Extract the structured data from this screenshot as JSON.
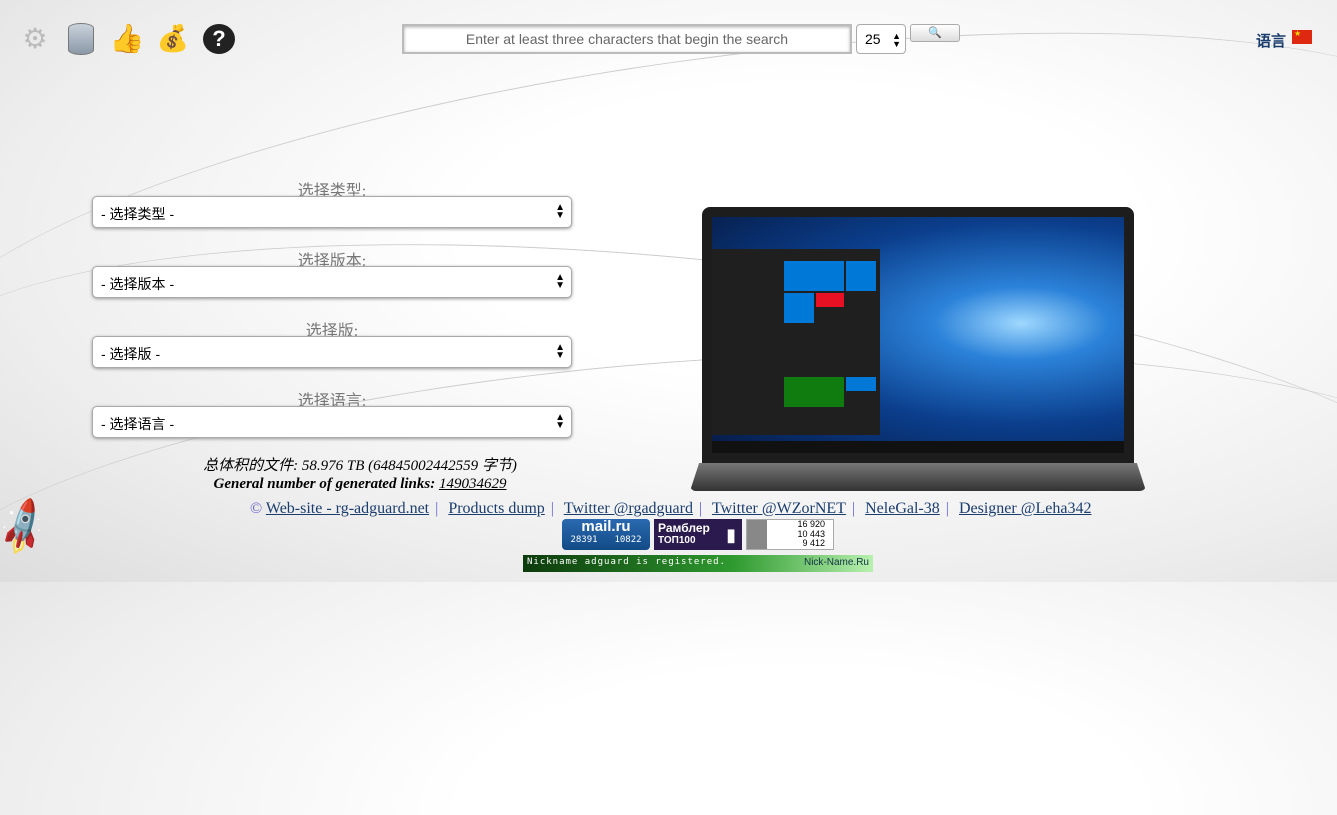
{
  "toolbar": {
    "icons": [
      "gear-icon",
      "database-icon",
      "thumbs-up-icon",
      "money-bag-icon",
      "help-icon"
    ]
  },
  "search": {
    "placeholder": "Enter at least three characters that begin the search",
    "count": "25",
    "button": "🔍"
  },
  "language": {
    "label": "语言",
    "flag": "china-flag"
  },
  "form": {
    "type_label": "选择类型:",
    "type_value": "- 选择类型 -",
    "version_label": "选择版本:",
    "version_value": "- 选择版本 -",
    "edition_label": "选择版:",
    "edition_value": "- 选择版 -",
    "lang_label": "选择语言:",
    "lang_value": "- 选择语言 -"
  },
  "stats": {
    "total_label": "总体积的文件:",
    "total_value": "58.976 TB (64845002442559 字节)",
    "links_label": "General number of generated links:",
    "links_value": "149034629"
  },
  "footer": {
    "copyright": "©",
    "links": [
      "Web-site - rg-adguard.net",
      "Products dump",
      "Twitter @rgadguard",
      "Twitter @WZorNET",
      "NeleGal-38",
      "Designer @Leha342"
    ]
  },
  "counters": {
    "mailru": {
      "logo": "mail.ru",
      "a": "28391",
      "b": "10822"
    },
    "rambler": {
      "title": "Рамблер",
      "sub": "ТОП100"
    },
    "li": {
      "views": "16 920",
      "visits": "10 443",
      "visitors": "9 412"
    },
    "nickname": {
      "text": "Nickname adguard is registered.",
      "brand": "Nick-Name.Ru"
    }
  }
}
